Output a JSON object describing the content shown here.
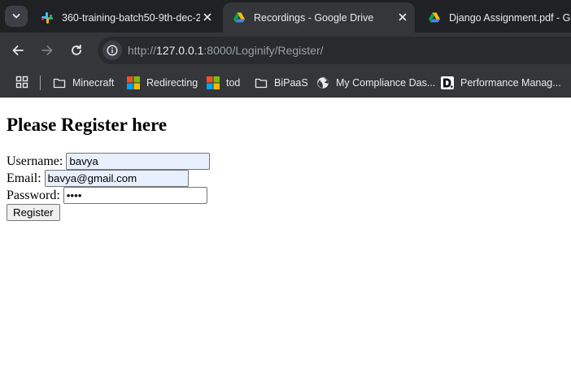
{
  "browser": {
    "tabs": [
      {
        "title": "360-training-batch50-9th-dec-2",
        "icon": "slack-icon",
        "active": false
      },
      {
        "title": "Recordings - Google Drive",
        "icon": "google-drive-icon",
        "active": true
      },
      {
        "title": "Django Assignment.pdf - Goo",
        "icon": "google-drive-icon",
        "active": false
      }
    ],
    "address": {
      "scheme": "http://",
      "host": "127.0.0.1",
      "rest": ":8000/Loginify/Register/"
    },
    "bookmarks": [
      {
        "label": "Minecraft",
        "icon": "folder-icon"
      },
      {
        "label": "Redirecting",
        "icon": "microsoft-icon"
      },
      {
        "label": "tod",
        "icon": "microsoft-icon"
      },
      {
        "label": "BiPaaS",
        "icon": "folder-icon"
      },
      {
        "label": "My Compliance Das...",
        "icon": "globe-icon"
      },
      {
        "label": "Performance Manag...",
        "icon": "d-logo-icon"
      }
    ],
    "colors": {
      "tab_strip": "#202124",
      "toolbar": "#35363a",
      "text": "#e8eaed"
    }
  },
  "page": {
    "heading": "Please Register here",
    "form": {
      "username_label": "Username:",
      "username_value": "bavya",
      "email_label": "Email:",
      "email_value": "bavya@gmail.com",
      "password_label": "Password:",
      "password_value": "bavy",
      "submit_label": "Register"
    }
  }
}
